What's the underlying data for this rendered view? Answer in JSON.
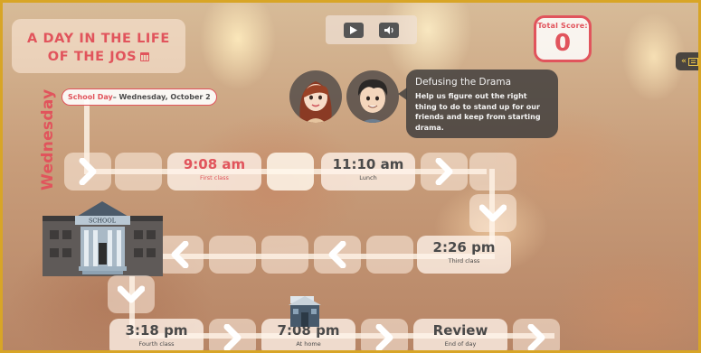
{
  "title": {
    "line1": "A DAY IN THE LIFE",
    "line2": "OF THE JOS",
    "icon": "calendar-icon"
  },
  "media": {
    "play_icon": "play-icon",
    "sound_icon": "speaker-icon"
  },
  "score": {
    "label": "Total Score:",
    "value": "0"
  },
  "side_tab": {
    "chevrons": "«",
    "icon": "notebook-icon"
  },
  "bubble": {
    "title": "Defusing the Drama",
    "text": "Help us figure out the right thing to do to stand up for our friends and keep from starting drama."
  },
  "day": {
    "vertical_label": "Wednesday",
    "banner_prefix": "School Day",
    "banner_suffix": " – Wednesday, October 2"
  },
  "stops": [
    {
      "time": "9:08 am",
      "label": "First class",
      "active": true
    },
    {
      "time": "11:10 am",
      "label": "Lunch",
      "active": false
    },
    {
      "time": "2:26 pm",
      "label": "Third class",
      "active": false
    },
    {
      "time": "3:18 pm",
      "label": "Fourth class",
      "active": false
    },
    {
      "time": "7:08 pm",
      "label": "At home",
      "active": false
    },
    {
      "time": "Review",
      "label": "End of day",
      "active": false
    }
  ],
  "building_sign": "SCHOOL",
  "colors": {
    "accent": "#e1545c",
    "frame": "#d8a526",
    "text_dark": "#4a4a4a",
    "bubble_bg": "#3c3a3a"
  }
}
